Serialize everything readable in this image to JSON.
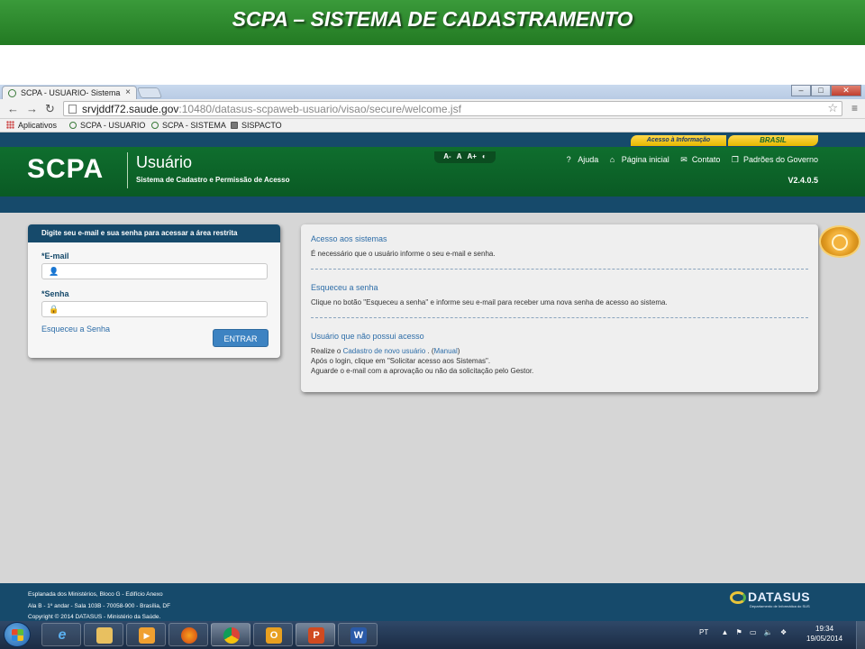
{
  "slide": {
    "title": "SCPA – SISTEMA DE CADASTRAMENTO"
  },
  "browser": {
    "tab_title": "SCPA - USUARIO- Sistema",
    "tab_close": "×",
    "url_host": "srvjddf72.saude.gov",
    "url_path": ":10480/datasus-scpaweb-usuario/visao/secure/welcome.jsf",
    "bookmarks": [
      "Aplicativos",
      "SCPA - USUARIO",
      "SCPA - SISTEMA",
      "SISPACTO"
    ]
  },
  "gov_bar": {
    "acesso": "Acesso à Informação",
    "brasil": "BRASIL"
  },
  "header": {
    "logo": "SCPA",
    "app_name": "Usuário",
    "app_subtitle": "Sistema de Cadastro e Permissão de Acesso",
    "font_controls": [
      "A-",
      "A",
      "A+"
    ],
    "links": [
      "Ajuda",
      "Página inicial",
      "Contato",
      "Padrões do Governo"
    ],
    "version": "V2.4.0.5"
  },
  "login": {
    "heading": "Digite seu e-mail e sua senha para acessar a área restrita",
    "email_label": "*E-mail",
    "email_value": "",
    "password_label": "*Senha",
    "password_value": "",
    "forgot": "Esqueceu a Senha",
    "submit": "ENTRAR"
  },
  "info": {
    "s1_title": "Acesso aos sistemas",
    "s1_text": "É necessário que o usuário informe o seu e-mail e senha.",
    "s2_title": "Esqueceu a senha",
    "s2_text": "Clique no botão \"Esqueceu a senha\" e informe seu e-mail para receber uma nova senha de acesso ao sistema.",
    "s3_title": "Usuário que não possui acesso",
    "s3_line1_pre": "Realize o ",
    "s3_line1_link1": "Cadastro de novo usuário",
    "s3_line1_mid": " . (",
    "s3_line1_link2": "Manual",
    "s3_line1_post": ")",
    "s3_line2": "Após o login, clique em \"Solicitar acesso aos Sistemas\".",
    "s3_line3": "Aguarde o e-mail com a aprovação ou não da solicitação pelo Gestor."
  },
  "footer": {
    "line1": "Esplanada dos Ministérios, Bloco G - Edifício Anexo",
    "line2": "Ala B - 1º andar - Sala 103B - 70058-900 - Brasília, DF",
    "line3": "Copyright © 2014 DATASUS - Ministério da Saúde.",
    "brand": "DATASUS",
    "brand_sub": "Departamento de Informática do SUS"
  },
  "taskbar": {
    "lang": "PT",
    "time": "19:34",
    "date": "19/05/2014"
  }
}
